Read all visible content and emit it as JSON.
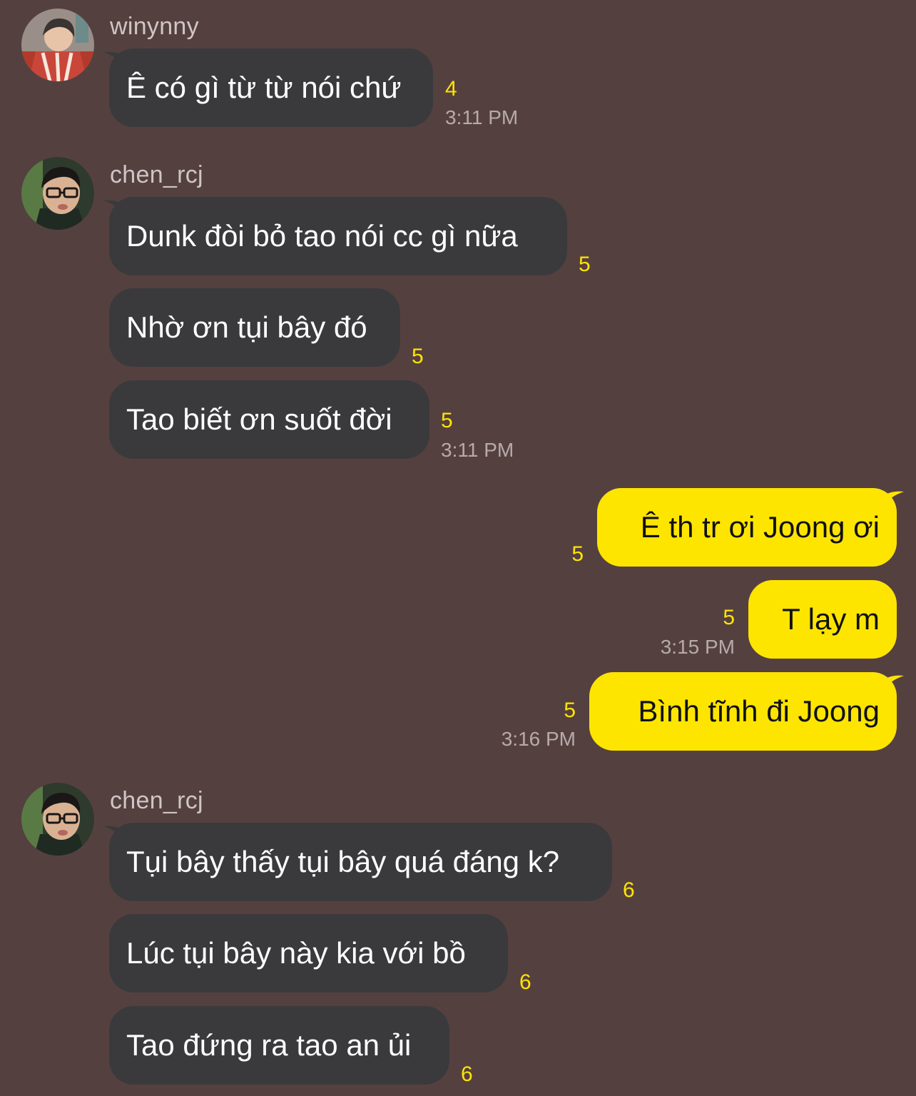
{
  "colors": {
    "background": "#554040",
    "incoming_bubble": "#3a3a3c",
    "outgoing_bubble": "#fee500",
    "unread_count": "#fee500",
    "timestamp": "#b7aaaa",
    "sender_name": "#cfc5c5"
  },
  "messages": [
    {
      "sender": "winynny",
      "bubbles": [
        {
          "text": "Ê có gì từ từ nói chứ",
          "unread": "4",
          "time": "3:11 PM"
        }
      ]
    },
    {
      "sender": "chen_rcj",
      "bubbles": [
        {
          "text": "Dunk đòi bỏ tao nói cc gì nữa",
          "unread": "5"
        },
        {
          "text": "Nhờ ơn tụi bây đó",
          "unread": "5"
        },
        {
          "text": "Tao biết ơn suốt đời",
          "unread": "5",
          "time": "3:11 PM"
        }
      ]
    },
    {
      "sender": "me",
      "bubbles": [
        {
          "text": "Ê th tr ơi Joong ơi",
          "unread": "5"
        },
        {
          "text": "T lạy m",
          "unread": "5",
          "time": "3:15 PM"
        },
        {
          "text": "Bình tĩnh đi Joong",
          "unread": "5",
          "time": "3:16 PM"
        }
      ]
    },
    {
      "sender": "chen_rcj",
      "bubbles": [
        {
          "text": "Tụi bây thấy tụi bây quá đáng k?",
          "unread": "6"
        },
        {
          "text": "Lúc tụi bây này kia với bồ",
          "unread": "6"
        },
        {
          "text": "Tao đứng ra tao an ủi",
          "unread": "6"
        }
      ]
    }
  ]
}
